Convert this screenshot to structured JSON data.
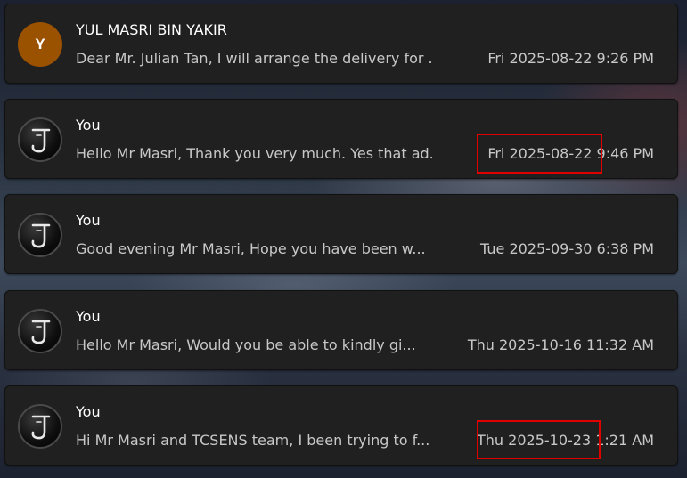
{
  "messages": [
    {
      "sender": "YUL MASRI BIN YAKIR",
      "avatar_initial": "Y",
      "avatar_color": "#9b5200",
      "preview": "Dear Mr. Julian Tan, I will arrange the delivery for ...",
      "time": "Fri 2025-08-22 9:26 PM"
    },
    {
      "sender": "You",
      "avatar_icon": "gothic-letter-j-icon",
      "preview": "Hello Mr Masri, Thank you very much. Yes that ad...",
      "time": "Fri 2025-08-22 9:46 PM",
      "highlighted": true
    },
    {
      "sender": "You",
      "avatar_icon": "gothic-letter-j-icon",
      "preview": "Good evening Mr Masri, Hope you have been w...",
      "time": "Tue 2025-09-30 6:38 PM"
    },
    {
      "sender": "You",
      "avatar_icon": "gothic-letter-j-icon",
      "preview": "Hello Mr Masri, Would you be able to kindly gi...",
      "time": "Thu 2025-10-16 11:32 AM"
    },
    {
      "sender": "You",
      "avatar_icon": "gothic-letter-j-icon",
      "preview": "Hi Mr Masri and TCSENS team, I been trying to f...",
      "time": "Thu 2025-10-23 1:21 AM",
      "highlighted": true
    }
  ],
  "annotation_color": "#e00000"
}
